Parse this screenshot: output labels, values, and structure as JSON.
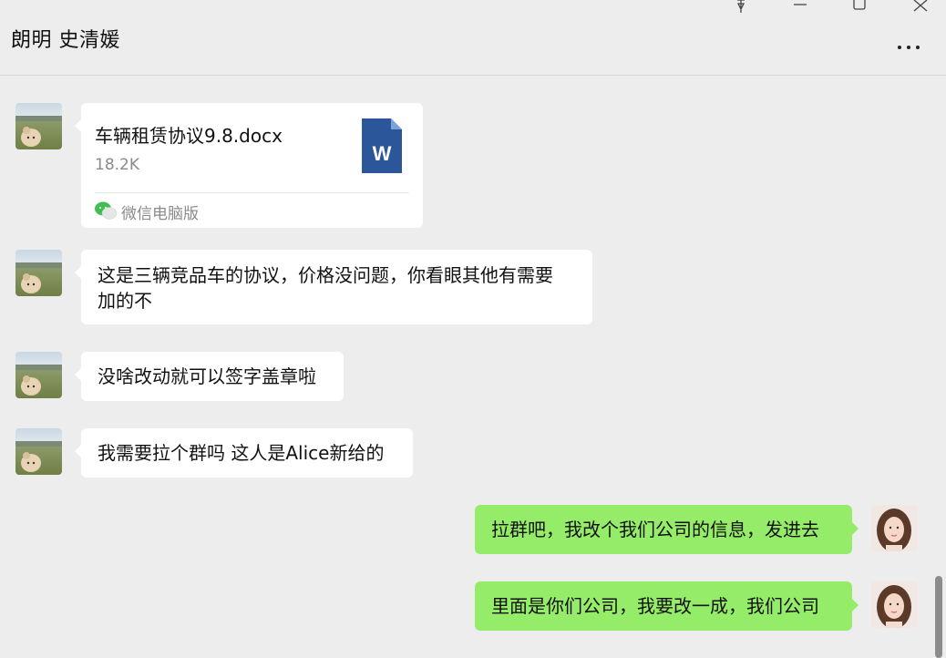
{
  "window": {
    "title": "朗明 史清媛",
    "icons": [
      "pin-icon",
      "minimize-icon",
      "maximize-icon",
      "close-icon",
      "more-icon"
    ]
  },
  "messages": [
    {
      "side": "left",
      "type": "file",
      "file_name": "车辆租赁协议9.8.docx",
      "file_size": "18.2K",
      "source": "微信电脑版",
      "file_icon": "word-doc-icon"
    },
    {
      "side": "left",
      "type": "text",
      "lines": [
        "这是三辆竞品车的协议，价格没问题，你看眼其他有需要",
        "加的不"
      ]
    },
    {
      "side": "left",
      "type": "text",
      "lines": [
        "没啥改动就可以签字盖章啦"
      ]
    },
    {
      "side": "left",
      "type": "text",
      "lines": [
        "我需要拉个群吗 这人是Alice新给的"
      ]
    },
    {
      "side": "right",
      "type": "text",
      "lines": [
        "拉群吧，我改个我们公司的信息，发进去"
      ]
    },
    {
      "side": "right",
      "type": "text",
      "lines": [
        "里面是你们公司，我要改一成，我们公司"
      ]
    }
  ],
  "colors": {
    "background": "#ededed",
    "left_bubble": "#ffffff",
    "right_bubble": "#95ec69",
    "word_blue": "#2b579a"
  }
}
